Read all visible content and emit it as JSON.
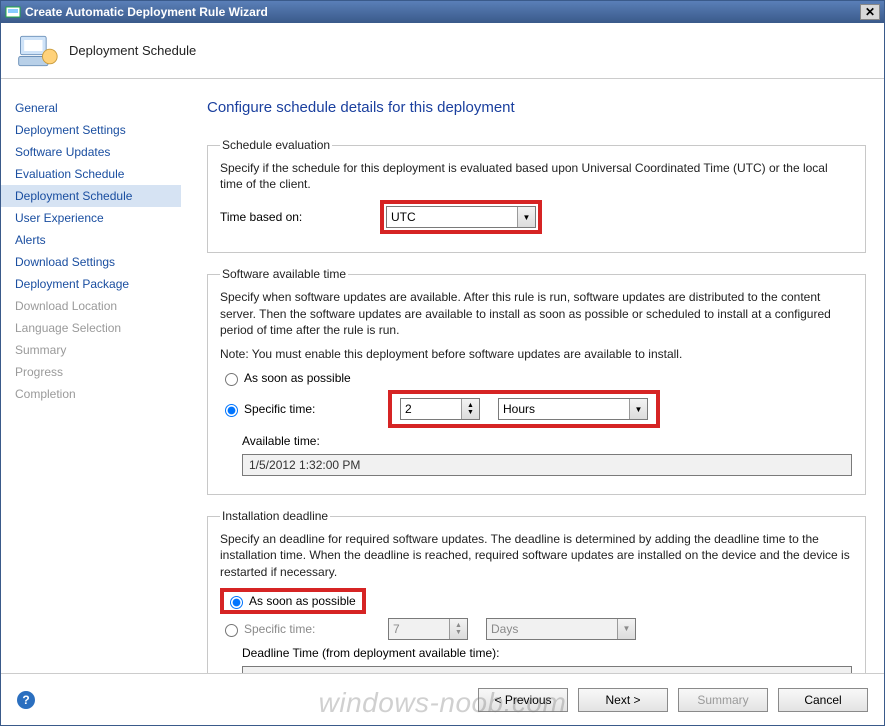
{
  "window": {
    "title": "Create Automatic Deployment Rule Wizard"
  },
  "header": {
    "title": "Deployment Schedule"
  },
  "sidebar": {
    "items": [
      {
        "label": "General",
        "state": "normal"
      },
      {
        "label": "Deployment Settings",
        "state": "normal"
      },
      {
        "label": "Software Updates",
        "state": "normal"
      },
      {
        "label": "Evaluation Schedule",
        "state": "normal"
      },
      {
        "label": "Deployment Schedule",
        "state": "selected"
      },
      {
        "label": "User Experience",
        "state": "normal"
      },
      {
        "label": "Alerts",
        "state": "normal"
      },
      {
        "label": "Download Settings",
        "state": "normal"
      },
      {
        "label": "Deployment Package",
        "state": "normal"
      },
      {
        "label": "Download Location",
        "state": "disabled"
      },
      {
        "label": "Language Selection",
        "state": "disabled"
      },
      {
        "label": "Summary",
        "state": "disabled"
      },
      {
        "label": "Progress",
        "state": "disabled"
      },
      {
        "label": "Completion",
        "state": "disabled"
      }
    ]
  },
  "page": {
    "title": "Configure schedule details for this deployment"
  },
  "schedule_eval": {
    "legend": "Schedule evaluation",
    "desc": "Specify if the schedule for this deployment is evaluated based upon Universal Coordinated Time (UTC) or the local time of the client.",
    "time_based_label": "Time based on:",
    "time_based_value": "UTC"
  },
  "avail": {
    "legend": "Software available time",
    "desc": "Specify when software updates are available. After this rule is run, software updates are distributed to the content server. Then the software updates are available to install as soon as possible or scheduled to install at a configured period of time after the rule is run.",
    "note": "Note: You must enable this deployment before software updates are available to install.",
    "opt_asap": "As soon as possible",
    "opt_specific": "Specific time:",
    "num_value": "2",
    "unit_value": "Hours",
    "available_time_label": "Available time:",
    "available_time_value": "1/5/2012 1:32:00 PM"
  },
  "deadline": {
    "legend": "Installation deadline",
    "desc": "Specify an deadline for required software updates. The deadline is determined by adding the deadline time to the installation time. When the deadline is reached, required software updates are installed on the device and the device is restarted if necessary.",
    "opt_asap": "As soon as possible",
    "opt_specific": "Specific time:",
    "num_value": "7",
    "unit_value": "Days",
    "deadline_time_label": "Deadline Time (from deployment available time):",
    "deadline_time_value": ""
  },
  "footer": {
    "previous": "< Previous",
    "next": "Next >",
    "summary": "Summary",
    "cancel": "Cancel"
  },
  "watermark": "windows-noob.com"
}
